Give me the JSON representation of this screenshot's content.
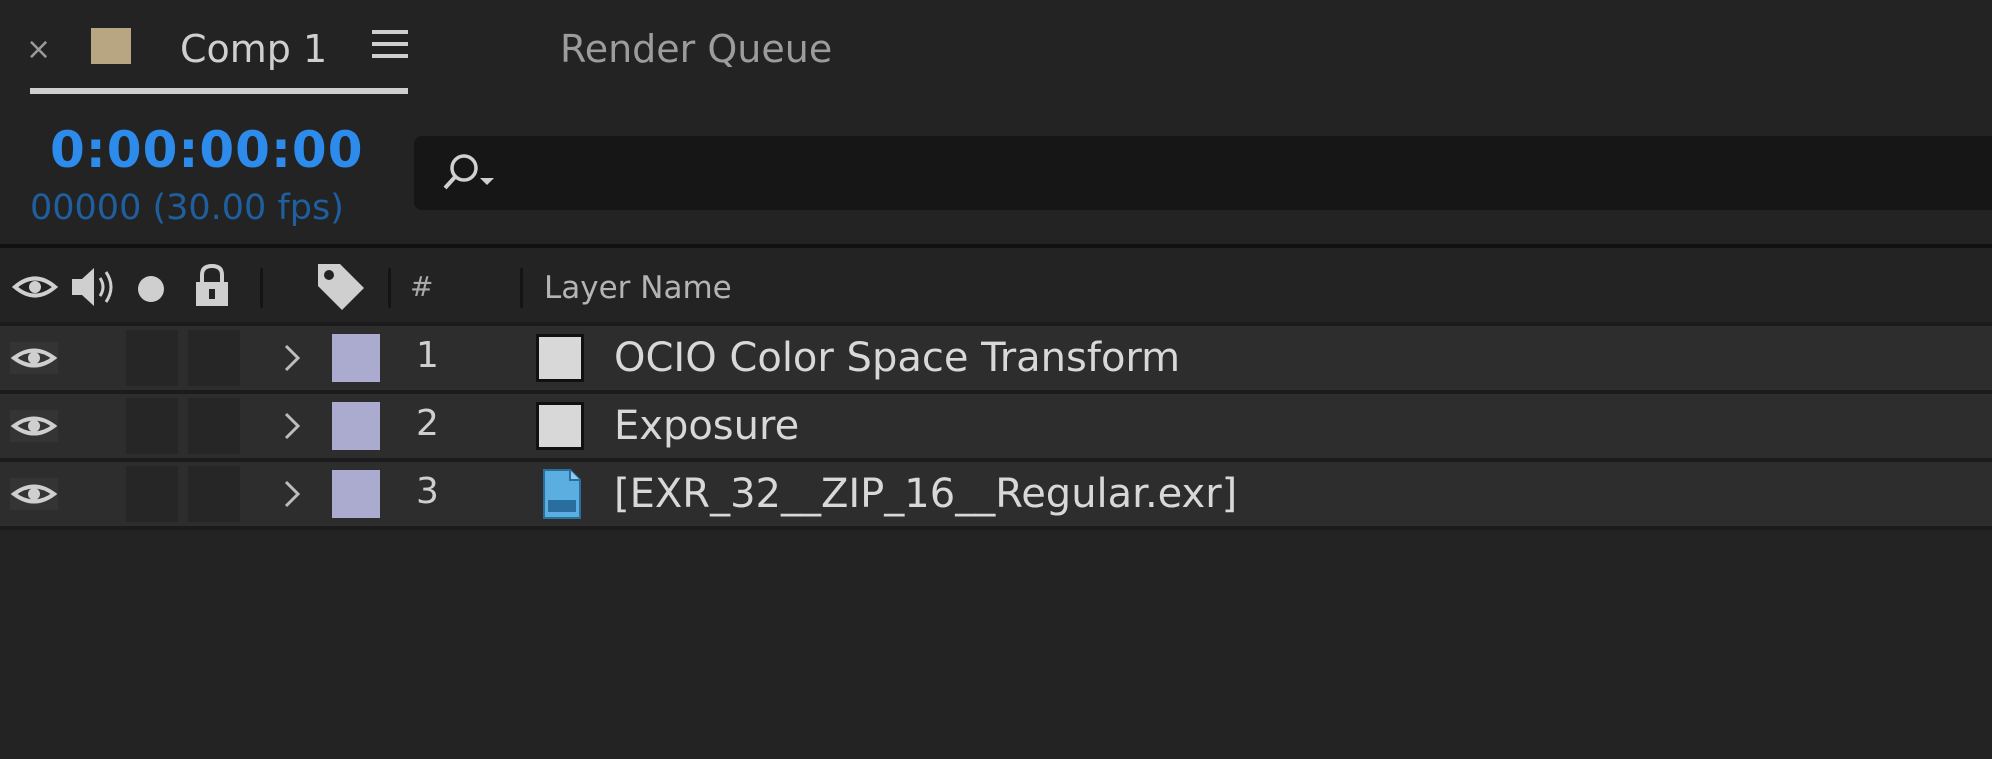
{
  "tabs": {
    "close_glyph": "×",
    "comp_title": "Comp 1",
    "render_queue": "Render Queue"
  },
  "time": {
    "timecode": "0:00:00:00",
    "frame_info": "00000 (30.00 fps)"
  },
  "search": {
    "value": ""
  },
  "columns": {
    "number": "#",
    "layer_name": "Layer Name",
    "icons": [
      "eye-icon",
      "speaker-icon",
      "solo-dot-icon",
      "lock-icon",
      "label-tag-icon"
    ]
  },
  "layers": [
    {
      "number": "1",
      "name": "OCIO Color Space Transform",
      "source": "solid",
      "label_color": "#ababcf"
    },
    {
      "number": "2",
      "name": "Exposure",
      "source": "solid",
      "label_color": "#ababcf"
    },
    {
      "number": "3",
      "name": "[EXR_32__ZIP_16__Regular.exr]",
      "source": "exr-file",
      "label_color": "#ababcf"
    }
  ],
  "colors": {
    "accent_timecode": "#2d8ceb",
    "comp_swatch": "#b8a581",
    "background": "#232323"
  }
}
